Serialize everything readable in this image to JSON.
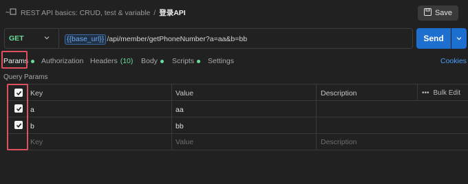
{
  "header": {
    "breadcrumb_collection": "REST API basics: CRUD, test & variable",
    "breadcrumb_separator": "/",
    "breadcrumb_current": "登录API",
    "save_label": "Save"
  },
  "request": {
    "method": "GET",
    "url_variable": "{{base_url}}",
    "url_path": "/api/member/getPhoneNumber?a=aa&b=bb",
    "send_label": "Send"
  },
  "tabs": [
    {
      "label": "Params"
    },
    {
      "label": "Authorization"
    },
    {
      "label": "Headers",
      "count": "(10)"
    },
    {
      "label": "Body"
    },
    {
      "label": "Scripts"
    },
    {
      "label": "Settings"
    }
  ],
  "cookies_label": "Cookies",
  "params": {
    "section_label": "Query Params",
    "columns": {
      "key": "Key",
      "value": "Value",
      "description": "Description"
    },
    "bulk_edit_label": "Bulk Edit",
    "rows": [
      {
        "key": "a",
        "value": "aa",
        "checked": true
      },
      {
        "key": "b",
        "value": "bb",
        "checked": true
      }
    ],
    "placeholder": {
      "key": "Key",
      "value": "Value",
      "description": "Description"
    }
  },
  "colors": {
    "background": "#212121",
    "accent_send": "#1f6fd1",
    "method_get": "#6bdd9a",
    "highlight_annotation": "#e0505e",
    "link": "#4a9eff"
  }
}
